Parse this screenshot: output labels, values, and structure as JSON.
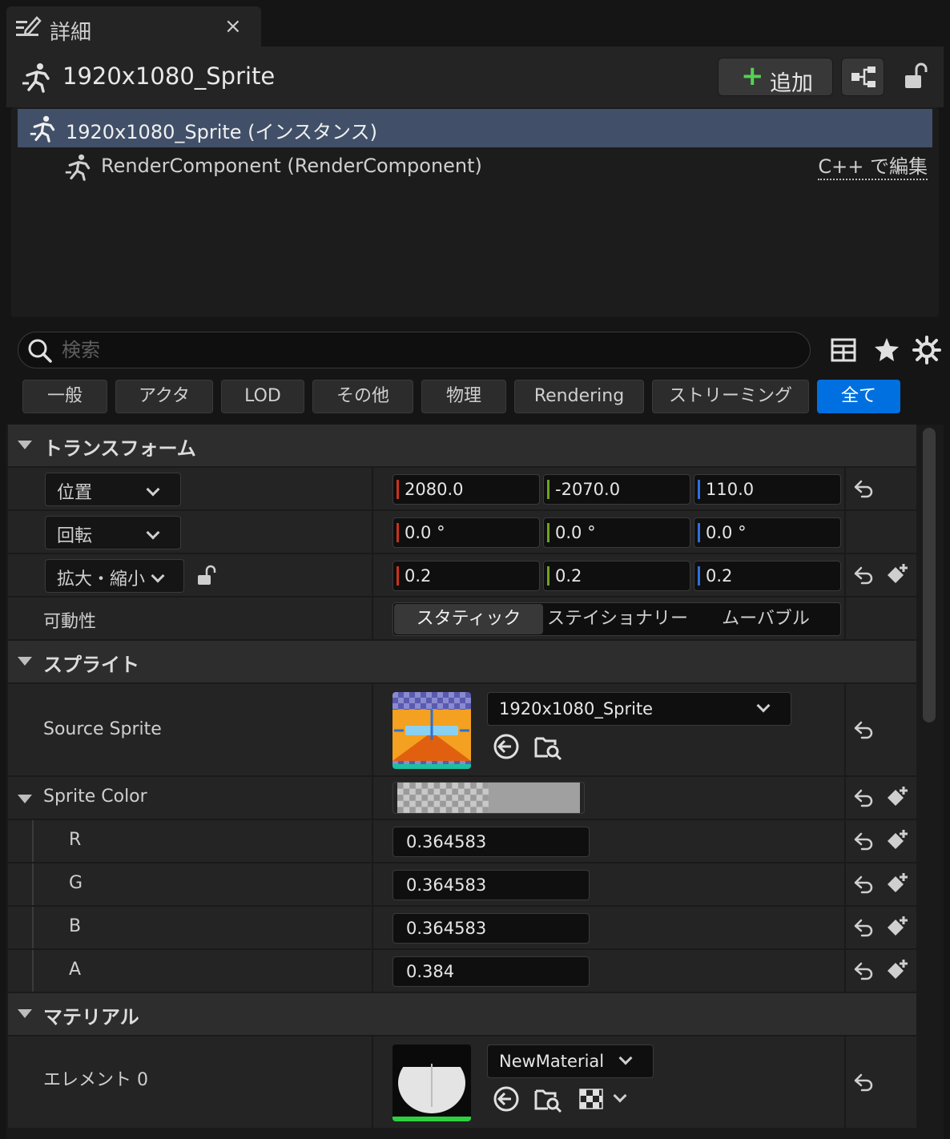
{
  "tab": {
    "title": "詳細",
    "close": "×"
  },
  "header": {
    "actor_name": "1920x1080_Sprite",
    "add_label": "追加",
    "add_plus": "+"
  },
  "tree": {
    "root": "1920x1080_Sprite (インスタンス)",
    "child": "RenderComponent (RenderComponent)",
    "cpp_edit": "C++ で編集"
  },
  "search": {
    "placeholder": "検索",
    "value": ""
  },
  "categories": [
    "一般",
    "アクタ",
    "LOD",
    "その他",
    "物理",
    "Rendering",
    "ストリーミング",
    "全て"
  ],
  "active_category": "全て",
  "transform": {
    "title": "トランスフォーム",
    "location": {
      "label": "位置",
      "x": "2080.0",
      "y": "-2070.0",
      "z": "110.0"
    },
    "rotation": {
      "label": "回転",
      "x": "0.0 °",
      "y": "0.0 °",
      "z": "0.0 °"
    },
    "scale": {
      "label": "拡大・縮小",
      "x": "0.2",
      "y": "0.2",
      "z": "0.2"
    },
    "mobility": {
      "label": "可動性",
      "options": [
        "スタティック",
        "ステイショナリー",
        "ムーバブル"
      ],
      "selected": "スタティック"
    }
  },
  "sprite": {
    "title": "スプライト",
    "source_label": "Source Sprite",
    "source_value": "1920x1080_Sprite",
    "color_label": "Sprite Color",
    "r_label": "R",
    "r": "0.364583",
    "g_label": "G",
    "g": "0.364583",
    "b_label": "B",
    "b": "0.364583",
    "a_label": "A",
    "a": "0.384"
  },
  "material": {
    "title": "マテリアル",
    "element_label": "エレメント 0",
    "element_value": "NewMaterial"
  },
  "colors": {
    "accent": "#0070e0",
    "selection": "#415068",
    "x_axis": "#c8321e",
    "y_axis": "#6ea51e",
    "z_axis": "#2e6fe0",
    "add_green": "#55d153"
  }
}
